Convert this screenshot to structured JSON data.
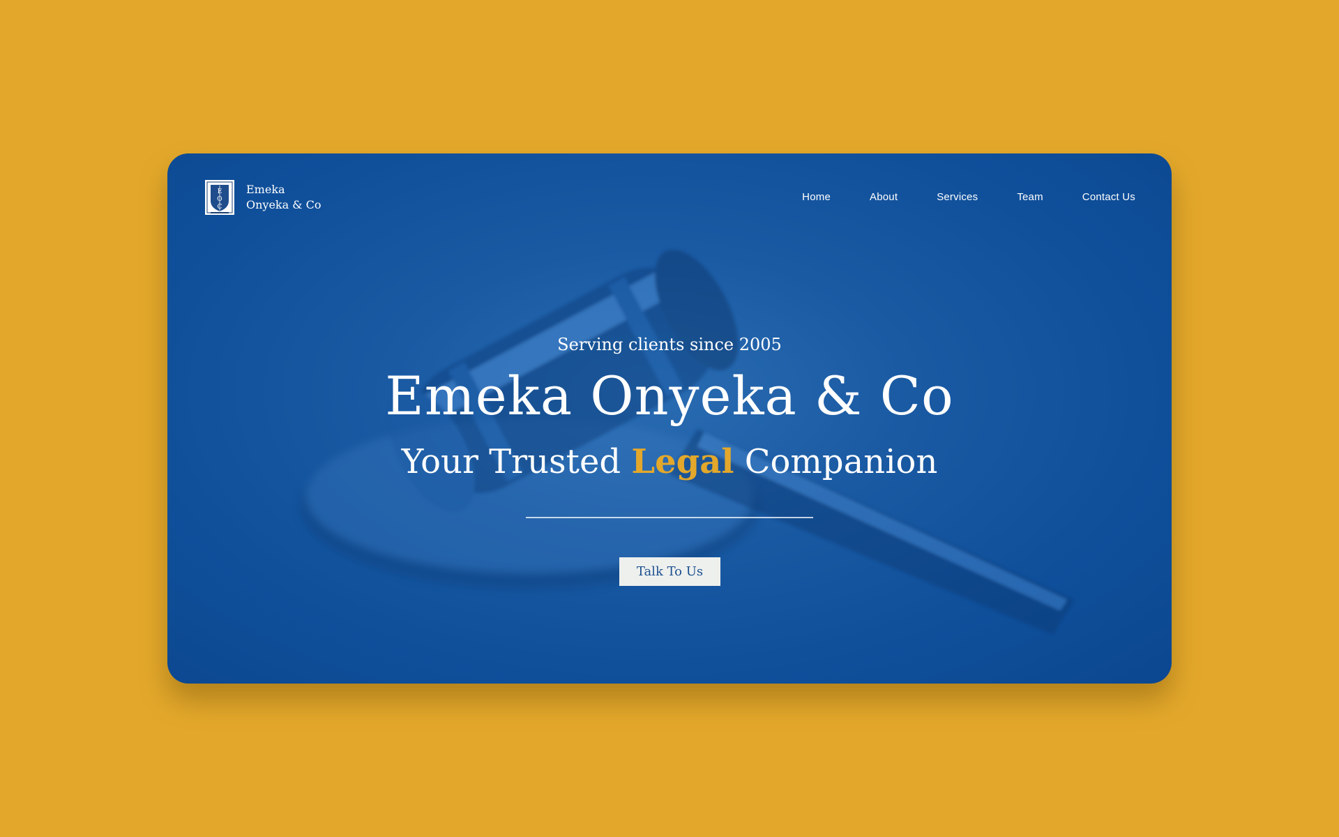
{
  "brand": {
    "name_line1": "Emeka",
    "name_line2": "Onyeka & Co",
    "logo_letters": [
      "E",
      "O",
      "C"
    ]
  },
  "nav": {
    "items": [
      {
        "label": "Home"
      },
      {
        "label": "About"
      },
      {
        "label": "Services"
      },
      {
        "label": "Team"
      },
      {
        "label": "Contact Us"
      }
    ]
  },
  "hero": {
    "since": "Serving clients since 2005",
    "title": "Emeka Onyeka & Co",
    "tagline_before": "Your Trusted ",
    "tagline_highlight": "Legal",
    "tagline_after": " Companion",
    "cta_label": "Talk To Us",
    "background_image": "gavel-image"
  },
  "colors": {
    "page_background": "#E3A82B",
    "card_blue": "#0f4f9a",
    "accent": "#E3A82B",
    "button_bg": "#eef0ee",
    "button_text": "#1a4f8f"
  }
}
